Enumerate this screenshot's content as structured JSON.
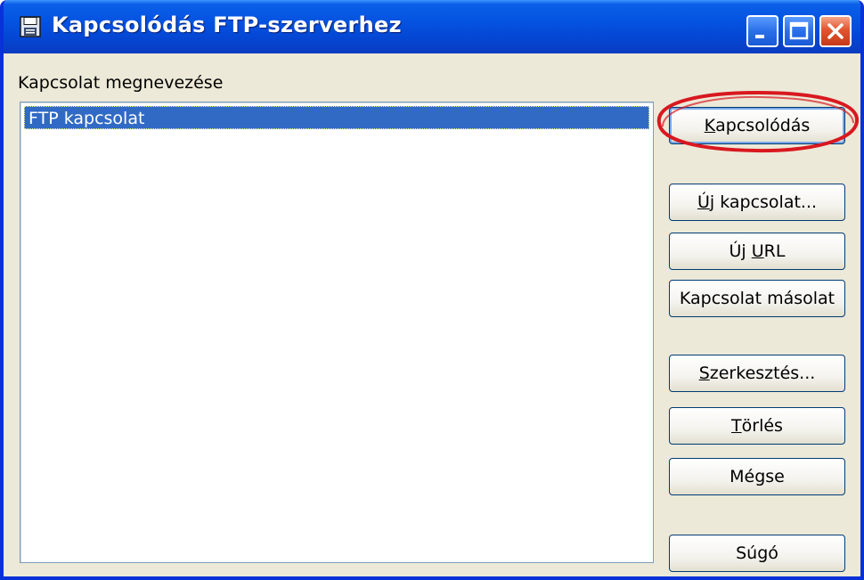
{
  "window": {
    "title": "Kapcsolódás FTP-szerverhez",
    "controls": [
      "minimize-icon",
      "maximize-icon",
      "close-icon"
    ]
  },
  "connections": {
    "label": "Kapcsolat megnevezése",
    "items": [
      {
        "label": "FTP kapcsolat",
        "selected": true
      }
    ]
  },
  "buttons": {
    "connect": {
      "pre": "",
      "mnemonic": "K",
      "post": "apcsolódás"
    },
    "new_connection": {
      "pre": "",
      "mnemonic": "Ú",
      "post": "j kapcsolat..."
    },
    "new_url": {
      "pre": "Új ",
      "mnemonic": "U",
      "post": "RL"
    },
    "copy_connection": {
      "label": "Kapcsolat másolat"
    },
    "edit": {
      "pre": "",
      "mnemonic": "S",
      "post": "zerkesztés..."
    },
    "delete": {
      "pre": "",
      "mnemonic": "T",
      "post": "örlés"
    },
    "cancel": {
      "label": "Mégse"
    },
    "help": {
      "label": "Súgó"
    }
  },
  "colors": {
    "titlebar": "#0553e1",
    "selection": "#316ac5",
    "annotation_ring": "#e3202a"
  }
}
